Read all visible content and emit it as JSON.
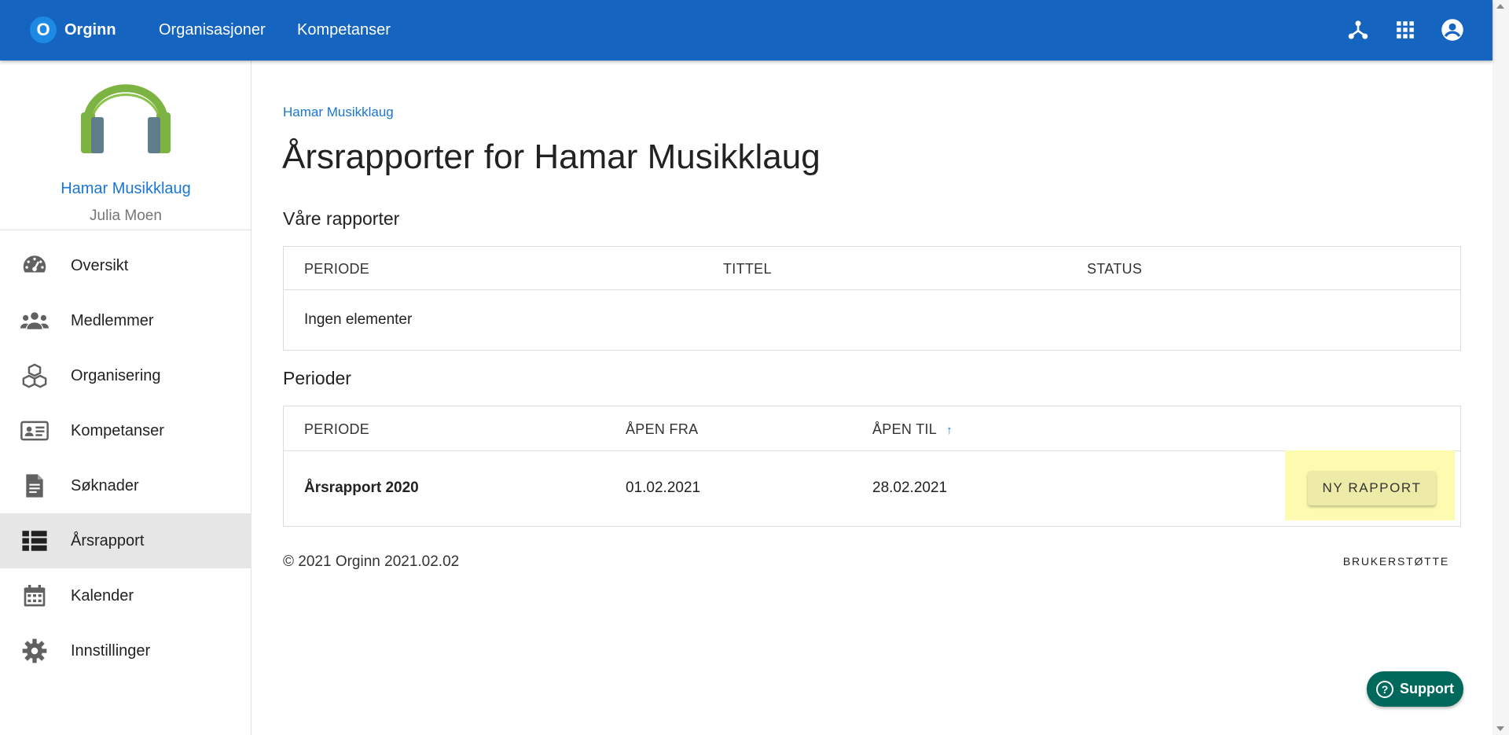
{
  "topbar": {
    "brand_letter": "O",
    "brand_name": "Orginn",
    "nav": [
      "Organisasjoner",
      "Kompetanser"
    ],
    "icons": [
      "hub-icon",
      "apps-grid-icon",
      "account-circle-icon"
    ]
  },
  "sidebar": {
    "org_name": "Hamar Musikklaug",
    "user_name": "Julia Moen",
    "items": [
      {
        "label": "Oversikt",
        "icon": "speedometer-icon"
      },
      {
        "label": "Medlemmer",
        "icon": "people-icon"
      },
      {
        "label": "Organisering",
        "icon": "cubes-icon"
      },
      {
        "label": "Kompetanser",
        "icon": "id-card-icon"
      },
      {
        "label": "Søknader",
        "icon": "document-icon"
      },
      {
        "label": "Årsrapport",
        "icon": "list-icon",
        "active": true
      },
      {
        "label": "Kalender",
        "icon": "calendar-icon"
      },
      {
        "label": "Innstillinger",
        "icon": "gear-icon"
      }
    ]
  },
  "main": {
    "breadcrumb": "Hamar Musikklaug",
    "title": "Årsrapporter for Hamar Musikklaug",
    "reports": {
      "heading": "Våre rapporter",
      "columns": [
        "PERIODE",
        "TITTEL",
        "STATUS"
      ],
      "empty_text": "Ingen elementer"
    },
    "periods": {
      "heading": "Perioder",
      "columns": [
        "PERIODE",
        "ÅPEN FRA",
        "ÅPEN TIL"
      ],
      "sort_indicator": "↑",
      "rows": [
        {
          "periode": "Årsrapport 2020",
          "apen_fra": "01.02.2021",
          "apen_til": "28.02.2021",
          "action": "NY RAPPORT"
        }
      ]
    }
  },
  "footer": {
    "copyright": "© 2021 Orginn 2021.02.02",
    "support_link": "BRUKERSTØTTE"
  },
  "support_button": {
    "label": "Support",
    "icon_glyph": "?"
  },
  "colors": {
    "primary": "#1565c0",
    "link": "#1976d2",
    "highlight": "#fdfbb0",
    "support": "#00695c"
  }
}
